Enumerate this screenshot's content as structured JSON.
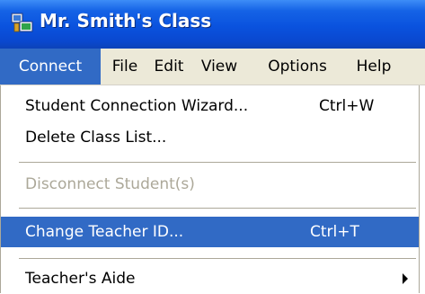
{
  "window": {
    "title": "Mr. Smith's Class",
    "icon": "app-icon"
  },
  "menubar": {
    "items": [
      {
        "label": "Connect",
        "active": true
      },
      {
        "label": "File"
      },
      {
        "label": "Edit"
      },
      {
        "label": "View"
      },
      {
        "label": "Options"
      },
      {
        "label": "Help"
      }
    ]
  },
  "menu": {
    "items": [
      {
        "label": "Student Connection Wizard...",
        "shortcut": "Ctrl+W"
      },
      {
        "label": "Delete Class List..."
      },
      {
        "label": "Disconnect Student(s)",
        "disabled": true
      },
      {
        "label": "Change Teacher ID...",
        "shortcut": "Ctrl+T",
        "highlighted": true
      },
      {
        "label": "Teacher's Aide",
        "submenu": true
      }
    ]
  },
  "colors": {
    "title_bar": "#0a52de",
    "highlight": "#316ac5",
    "menubar_bg": "#ece9d8",
    "disabled_text": "#aca899"
  }
}
